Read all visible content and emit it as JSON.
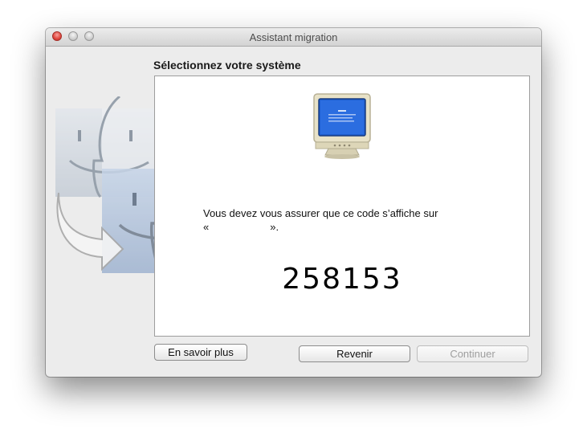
{
  "window": {
    "title": "Assistant migration"
  },
  "content": {
    "section_title": "Sélectionnez votre système",
    "message_line1": "Vous devez vous assurer que ce code s’affiche sur",
    "message_open_quote": "«",
    "message_close_quote": "».",
    "code": "258153"
  },
  "buttons": {
    "learn_more": "En savoir plus",
    "back": "Revenir",
    "continue": "Continuer"
  },
  "icons": {
    "window_buttons": [
      "close-icon",
      "minimize-icon",
      "zoom-icon"
    ],
    "illustration": "finder-migration-illustration",
    "monitor": "pc-monitor-icon"
  },
  "colors": {
    "close": "#e0443c",
    "screen_blue": "#1f5fd0",
    "monitor_beige": "#e8e2c8"
  }
}
